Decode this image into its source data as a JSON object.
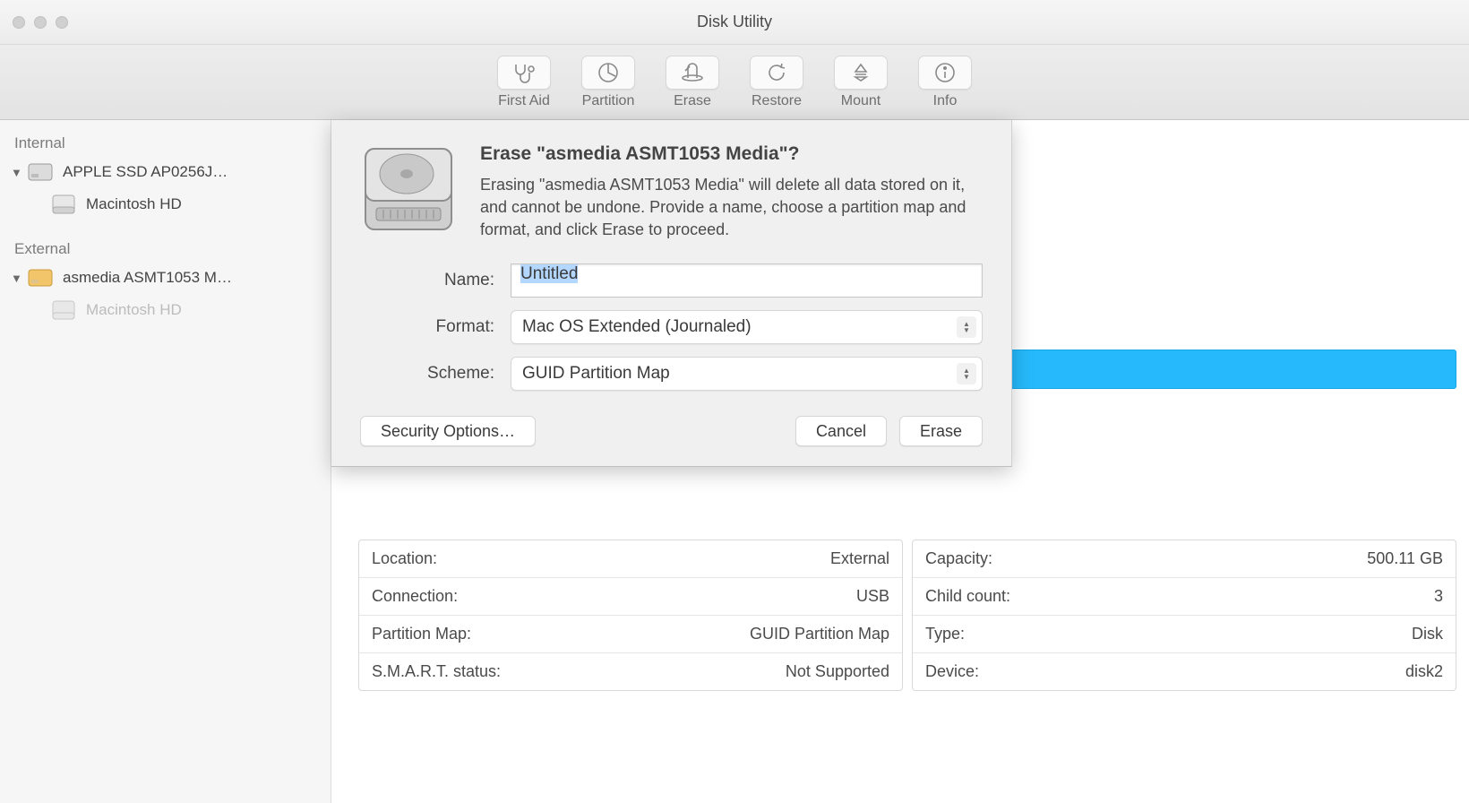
{
  "window_title": "Disk Utility",
  "toolbar": [
    {
      "label": "First Aid",
      "icon": "stethoscope"
    },
    {
      "label": "Partition",
      "icon": "piechart"
    },
    {
      "label": "Erase",
      "icon": "erase"
    },
    {
      "label": "Restore",
      "icon": "restore"
    },
    {
      "label": "Mount",
      "icon": "mount"
    },
    {
      "label": "Info",
      "icon": "info"
    }
  ],
  "sidebar": {
    "internal_header": "Internal",
    "external_header": "External",
    "internal": [
      {
        "label": "APPLE SSD AP0256J…",
        "children": [
          {
            "label": "Macintosh HD"
          }
        ]
      }
    ],
    "external": [
      {
        "label": "asmedia ASMT1053 M…",
        "children": [
          {
            "label": "Macintosh HD",
            "dim": true
          }
        ]
      }
    ]
  },
  "info_left": [
    {
      "k": "Location:",
      "v": "External"
    },
    {
      "k": "Connection:",
      "v": "USB"
    },
    {
      "k": "Partition Map:",
      "v": "GUID Partition Map"
    },
    {
      "k": "S.M.A.R.T. status:",
      "v": "Not Supported"
    }
  ],
  "info_right": [
    {
      "k": "Capacity:",
      "v": "500.11 GB"
    },
    {
      "k": "Child count:",
      "v": "3"
    },
    {
      "k": "Type:",
      "v": "Disk"
    },
    {
      "k": "Device:",
      "v": "disk2"
    }
  ],
  "sheet": {
    "title": "Erase \"asmedia ASMT1053 Media\"?",
    "body": "Erasing \"asmedia ASMT1053 Media\" will delete all data stored on it, and cannot be undone. Provide a name, choose a partition map and format, and click Erase to proceed.",
    "fields": {
      "name_label": "Name:",
      "name_value": "Untitled",
      "format_label": "Format:",
      "format_value": "Mac OS Extended (Journaled)",
      "scheme_label": "Scheme:",
      "scheme_value": "GUID Partition Map"
    },
    "buttons": {
      "security": "Security Options…",
      "cancel": "Cancel",
      "erase": "Erase"
    }
  }
}
